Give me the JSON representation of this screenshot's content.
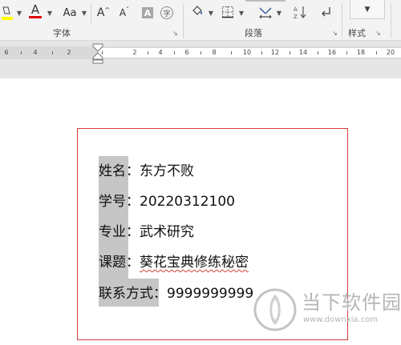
{
  "ribbon": {
    "font_group_label": "字体",
    "paragraph_group_label": "段落",
    "styles_group_label": "样式",
    "change_case_label": "Aa",
    "font_color_letter": "A",
    "grow_font_label": "A",
    "shrink_font_label": "A",
    "char_shading_label": "A",
    "enclose_char_label": "字",
    "sort_label": "↓",
    "launcher_glyph": "↘",
    "colors": {
      "highlight_yellow": "#ffff00",
      "font_red": "#e00000",
      "accent_blue": "#2b579a"
    }
  },
  "ruler": {
    "labels": [
      "6",
      "4",
      "2",
      "2",
      "4",
      "6",
      "8",
      "10",
      "12",
      "14",
      "16",
      "18",
      "20"
    ]
  },
  "document": {
    "lines": [
      {
        "label": "姓名：",
        "value": "东方不败"
      },
      {
        "label": "学号：",
        "value": "20220312100"
      },
      {
        "label": "专业：",
        "value": "武术研究"
      },
      {
        "label": "课题：",
        "value": "葵花宝典修练秘密"
      },
      {
        "label": "联系方式：",
        "value": "9999999999"
      }
    ],
    "colors": {
      "textbox_border": "#d23b3b",
      "selection": "#c6c6c6",
      "spell_squiggle": "#d9413c"
    }
  },
  "watermark": {
    "name": "当下软件园",
    "url": "www.downxia.com"
  }
}
